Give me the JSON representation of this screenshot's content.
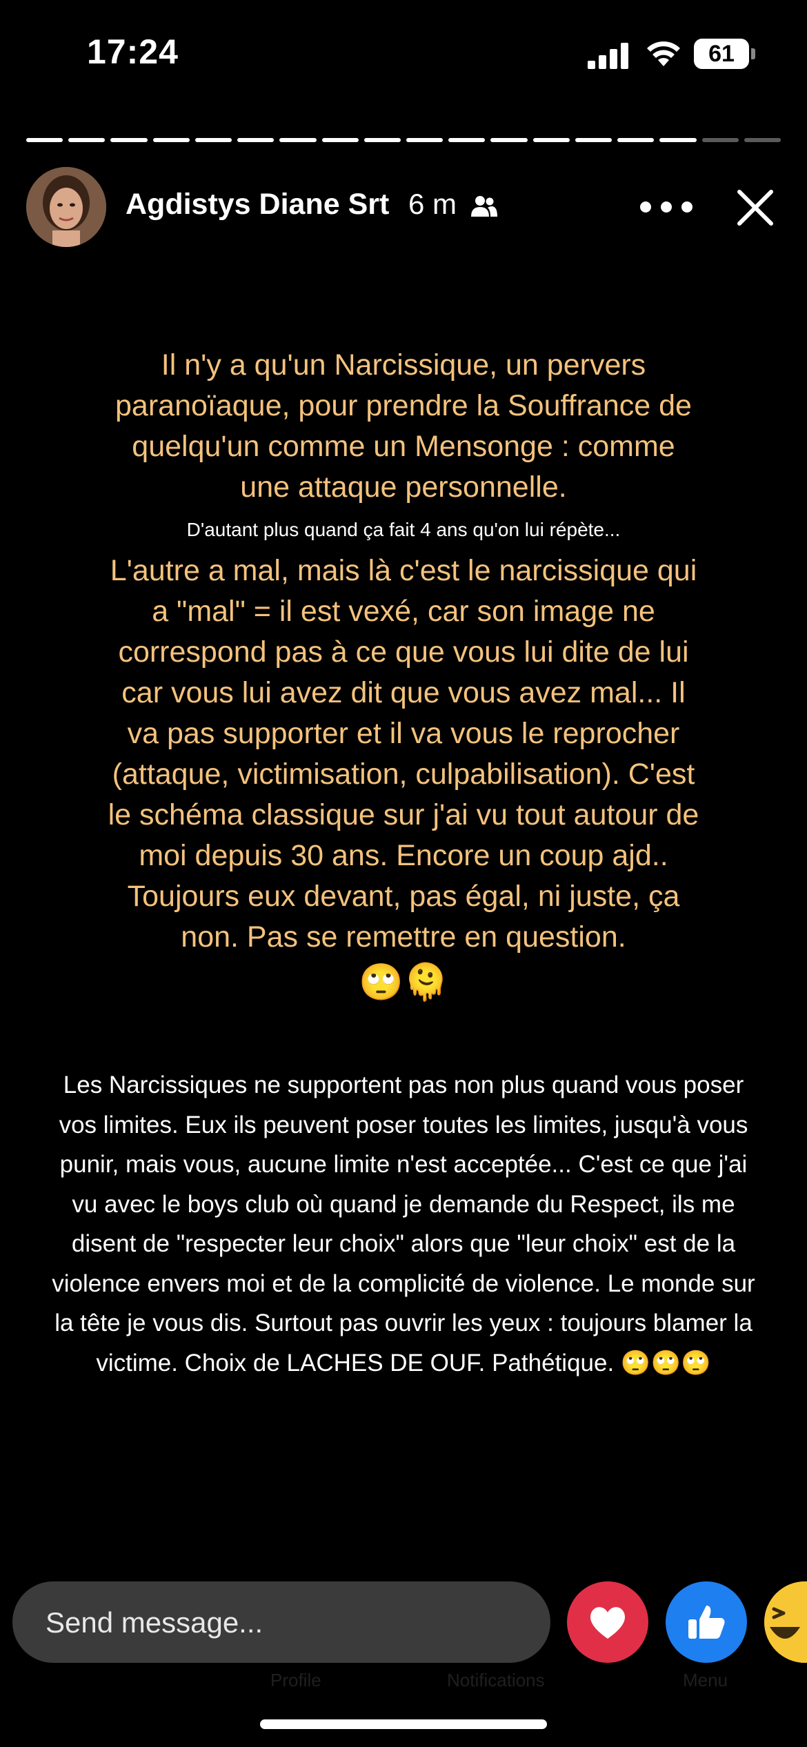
{
  "status_bar": {
    "time": "17:24",
    "battery": "61"
  },
  "story": {
    "total_segments": 18,
    "completed_segments": 16,
    "author": "Agdistys Diane Srt",
    "posted": "6 m",
    "icons": {
      "audience": "friends-icon",
      "more": "more-icon",
      "close": "close-icon"
    },
    "yellow_paragraph_1": "Il n'y a qu'un Narcissique, un pervers paranoïaque, pour prendre la Souffrance de quelqu'un comme un Mensonge : comme une attaque personnelle.",
    "small_note": "D'autant plus quand ça fait 4 ans qu'on lui répète...",
    "yellow_paragraph_2": "L'autre a mal, mais là c'est le narcissique qui a \"mal\" = il est vexé, car son image ne correspond pas à ce que vous lui dite de lui car vous lui avez dit que vous avez mal... Il va pas supporter et il va vous le reprocher (attaque, victimisation, culpabilisation). C'est le schéma classique sur j'ai vu tout autour de moi depuis 30 ans. Encore un coup ajd.. Toujours eux devant, pas égal, ni juste, ça non. Pas se remettre en question.",
    "emojis_1": "🙄🫠",
    "white_paragraph": "Les Narcissiques ne supportent pas non plus quand vous poser vos limites. Eux ils peuvent poser toutes les limites, jusqu'à vous punir, mais vous, aucune limite n'est acceptée... C'est ce que j'ai vu avec le boys club où quand je demande du Respect, ils me disent de \"respecter leur choix\" alors que \"leur choix\" est de la violence envers moi et de la complicité de violence. Le monde sur la tête je vous dis. Surtout pas ouvrir les yeux : toujours blamer la victime. Choix de LACHES DE OUF. Pathétique. 🙄🙄🙄"
  },
  "composer": {
    "placeholder": "Send message..."
  },
  "reactions": [
    "heart-icon",
    "like-icon",
    "haha-icon"
  ],
  "ghost_nav": {
    "profile": "Profile",
    "notifications": "Notifications",
    "menu": "Menu"
  },
  "colors": {
    "yellow_text": "#f4c27d",
    "heart": "#e12f48",
    "like": "#1e7ff0",
    "input_bg": "#3b3b3b"
  }
}
